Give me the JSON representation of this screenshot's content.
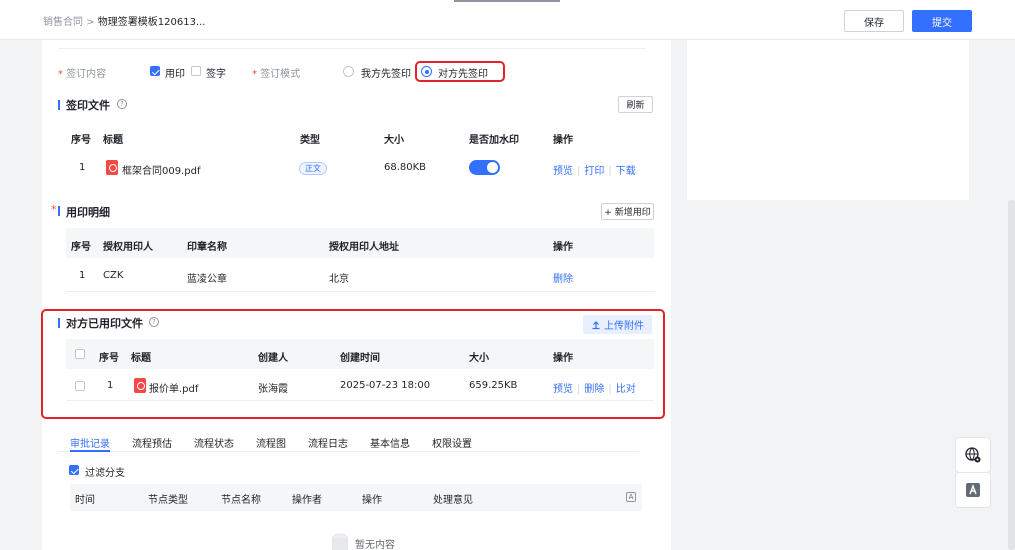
{
  "header": {
    "breadcrumb_parent": "销售合同",
    "breadcrumb_sep": ">",
    "breadcrumb_current": "物理签署模板120613...",
    "save_label": "保存",
    "submit_label": "提交"
  },
  "sign_settings": {
    "content_label": "签订内容",
    "content_options": [
      {
        "label": "用印",
        "checked": true
      },
      {
        "label": "签字",
        "checked": false
      }
    ],
    "mode_label": "签订模式",
    "mode_options": [
      {
        "label": "我方先签印",
        "selected": false
      },
      {
        "label": "对方先签印",
        "selected": true
      }
    ]
  },
  "sign_files": {
    "title": "签印文件",
    "refresh_label": "刷新",
    "columns": [
      "序号",
      "标题",
      "类型",
      "大小",
      "是否加水印",
      "操作"
    ],
    "rows": [
      {
        "index": "1",
        "title": "框架合同009.pdf",
        "type": "正文",
        "size": "68.80KB",
        "watermark": true,
        "actions": [
          "预览",
          "打印",
          "下载"
        ]
      }
    ]
  },
  "seal_detail": {
    "title": "用印明细",
    "add_label": "+ 新增用印",
    "columns": [
      "序号",
      "授权用印人",
      "印章名称",
      "授权用印人地址",
      "操作"
    ],
    "rows": [
      {
        "index": "1",
        "person": "CZK",
        "seal": "蓝凌公章",
        "address": "北京",
        "action": "删除"
      }
    ]
  },
  "counterparty_files": {
    "title": "对方已用印文件",
    "upload_label": "上传附件",
    "columns": [
      "序号",
      "标题",
      "创建人",
      "创建时间",
      "大小",
      "操作"
    ],
    "rows": [
      {
        "index": "1",
        "title": "报价单.pdf",
        "creator": "张海霞",
        "created": "2025-07-23 18:00",
        "size": "659.25KB",
        "actions": [
          "预览",
          "删除",
          "比对"
        ]
      }
    ]
  },
  "bottom_tabs": {
    "items": [
      "审批记录",
      "流程预估",
      "流程状态",
      "流程图",
      "流程日志",
      "基本信息",
      "权限设置"
    ],
    "active": 0
  },
  "approval": {
    "filter_label": "过滤分支",
    "columns": [
      "时间",
      "节点类型",
      "节点名称",
      "操作者",
      "操作",
      "处理意见"
    ],
    "empty_text": "暂无内容"
  },
  "side_tools": [
    "globe-settings-icon",
    "font-a-icon"
  ],
  "colors": {
    "accent": "#3370ff",
    "highlight": "#e0242c",
    "danger": "#f54a45"
  }
}
